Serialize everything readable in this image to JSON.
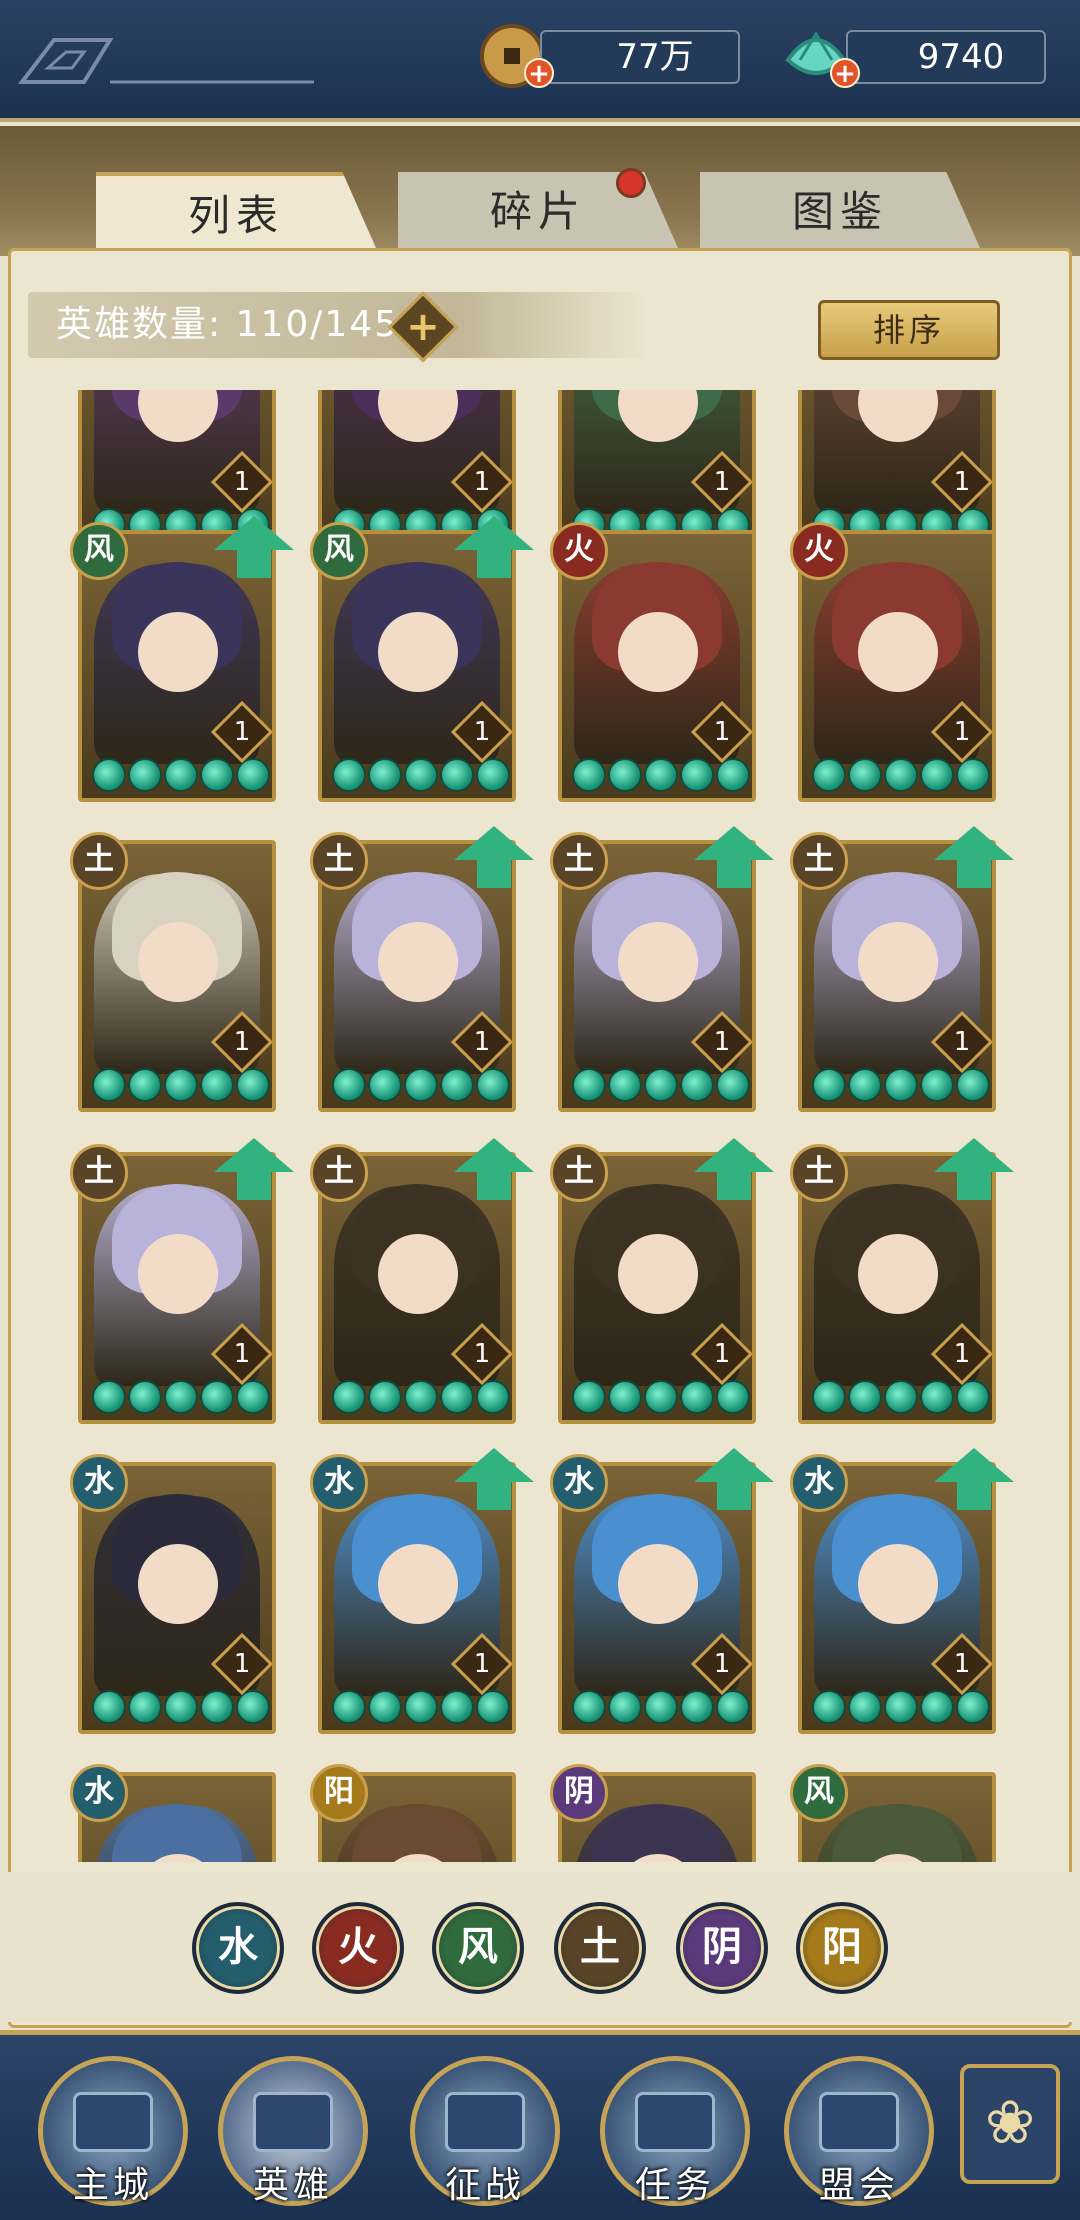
{
  "topbar": {
    "coins": {
      "value": "77万",
      "icon": "copper-coin-icon"
    },
    "jade": {
      "value": "9740",
      "icon": "jade-shell-icon"
    }
  },
  "tabs": [
    {
      "label": "列表",
      "active": true
    },
    {
      "label": "碎片",
      "active": false,
      "badge": true
    },
    {
      "label": "图鉴",
      "active": false
    }
  ],
  "hero_count": {
    "label": "英雄数量:",
    "value": "110/145"
  },
  "sort_button": {
    "label": "排序"
  },
  "elements": {
    "water": {
      "glyph": "水",
      "color": "#245d6b"
    },
    "fire": {
      "glyph": "火",
      "color": "#8a2b22"
    },
    "wind": {
      "glyph": "风",
      "color": "#2f6b3c"
    },
    "earth": {
      "glyph": "土",
      "color": "#5a4428"
    },
    "yin": {
      "glyph": "阴",
      "color": "#5b3a7c"
    },
    "yang": {
      "glyph": "阳",
      "color": "#a57a1a"
    }
  },
  "cards": [
    {
      "element": "none",
      "level": "1",
      "upgrade": false,
      "palette": "#5a3a6a",
      "partial": "top"
    },
    {
      "element": "none",
      "level": "1",
      "upgrade": false,
      "palette": "#4a2f5a",
      "partial": "top"
    },
    {
      "element": "none",
      "level": "1",
      "upgrade": false,
      "palette": "#3f6b4a",
      "partial": "top"
    },
    {
      "element": "none",
      "level": "1",
      "upgrade": false,
      "palette": "#6b4a3a",
      "partial": "top"
    },
    {
      "element": "wind",
      "level": "1",
      "upgrade": true,
      "palette": "#3a335a"
    },
    {
      "element": "wind",
      "level": "1",
      "upgrade": true,
      "palette": "#3a335a"
    },
    {
      "element": "fire",
      "level": "1",
      "upgrade": false,
      "palette": "#8a3a2f"
    },
    {
      "element": "fire",
      "level": "1",
      "upgrade": false,
      "palette": "#8a3a2f"
    },
    {
      "element": "earth",
      "level": "1",
      "upgrade": false,
      "palette": "#d8d2c2"
    },
    {
      "element": "earth",
      "level": "1",
      "upgrade": true,
      "palette": "#b9b3d9"
    },
    {
      "element": "earth",
      "level": "1",
      "upgrade": true,
      "palette": "#b9b3d9"
    },
    {
      "element": "earth",
      "level": "1",
      "upgrade": true,
      "palette": "#b9b3d9"
    },
    {
      "element": "earth",
      "level": "1",
      "upgrade": true,
      "palette": "#b9b3d9"
    },
    {
      "element": "earth",
      "level": "1",
      "upgrade": true,
      "palette": "#3b3224"
    },
    {
      "element": "earth",
      "level": "1",
      "upgrade": true,
      "palette": "#3b3224"
    },
    {
      "element": "earth",
      "level": "1",
      "upgrade": true,
      "palette": "#3b3224"
    },
    {
      "element": "water",
      "level": "1",
      "upgrade": false,
      "palette": "#2a2a3a"
    },
    {
      "element": "water",
      "level": "1",
      "upgrade": true,
      "palette": "#4a8fd0"
    },
    {
      "element": "water",
      "level": "1",
      "upgrade": true,
      "palette": "#4a8fd0"
    },
    {
      "element": "water",
      "level": "1",
      "upgrade": true,
      "palette": "#4a8fd0"
    },
    {
      "element": "water",
      "level": "",
      "upgrade": false,
      "palette": "#4a6fa0",
      "partial": "bottom"
    },
    {
      "element": "yang",
      "level": "",
      "upgrade": false,
      "palette": "#6a4a30",
      "partial": "bottom"
    },
    {
      "element": "yin",
      "level": "",
      "upgrade": false,
      "palette": "#3a3450",
      "partial": "bottom"
    },
    {
      "element": "wind",
      "level": "",
      "upgrade": false,
      "palette": "#4a5a3a",
      "partial": "bottom"
    }
  ],
  "filters": [
    "water",
    "fire",
    "wind",
    "earth",
    "yin",
    "yang"
  ],
  "nav": [
    {
      "label": "主城",
      "icon": "palace-icon",
      "active": false
    },
    {
      "label": "英雄",
      "icon": "hero-portrait-icon",
      "active": true
    },
    {
      "label": "征战",
      "icon": "battle-horn-icon",
      "active": false
    },
    {
      "label": "任务",
      "icon": "quest-scroll-icon",
      "active": false
    },
    {
      "label": "盟会",
      "icon": "guild-gate-icon",
      "active": false
    }
  ],
  "menu_icon": "menu-flower-icon"
}
